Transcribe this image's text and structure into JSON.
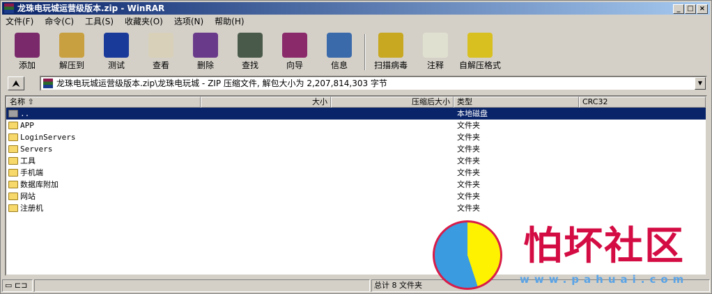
{
  "window": {
    "title": "龙珠电玩城运营级版本.zip - WinRAR",
    "min": "_",
    "max": "□",
    "close": "×"
  },
  "menu": [
    "文件(F)",
    "命令(C)",
    "工具(S)",
    "收藏夹(O)",
    "选项(N)",
    "帮助(H)"
  ],
  "toolbar": [
    {
      "label": "添加",
      "color": "#7a2a6a"
    },
    {
      "label": "解压到",
      "color": "#c8a040"
    },
    {
      "label": "测试",
      "color": "#1a3a9a"
    },
    {
      "label": "查看",
      "color": "#d8d0b8"
    },
    {
      "label": "删除",
      "color": "#6a3a8a"
    },
    {
      "label": "查找",
      "color": "#4a5a4a"
    },
    {
      "label": "向导",
      "color": "#8a2a6a"
    },
    {
      "label": "信息",
      "color": "#3a6aaa"
    }
  ],
  "toolbar2": [
    {
      "label": "扫描病毒",
      "color": "#c8a820"
    },
    {
      "label": "注释",
      "color": "#e0e0d0"
    },
    {
      "label": "自解压格式",
      "color": "#d8c020"
    }
  ],
  "address": {
    "up": "⮝",
    "path": "龙珠电玩城运营级版本.zip\\龙珠电玩城 - ZIP 压缩文件, 解包大小为 2,207,814,303 字节",
    "dropdown": "▼"
  },
  "columns": {
    "name": "名称 ⇧",
    "size": "大小",
    "packed": "压缩后大小",
    "type": "类型",
    "crc": "CRC32"
  },
  "rows": [
    {
      "name": "..",
      "type": "本地磁盘",
      "selected": true
    },
    {
      "name": "APP",
      "type": "文件夹"
    },
    {
      "name": "LoginServers",
      "type": "文件夹"
    },
    {
      "name": "Servers",
      "type": "文件夹"
    },
    {
      "name": "工具",
      "type": "文件夹"
    },
    {
      "name": "手机端",
      "type": "文件夹"
    },
    {
      "name": "数据库附加",
      "type": "文件夹"
    },
    {
      "name": "网站",
      "type": "文件夹"
    },
    {
      "name": "注册机",
      "type": "文件夹"
    }
  ],
  "status": {
    "left": "▭ ⊏⊐",
    "total": "总计 8 文件夹"
  },
  "watermark": {
    "name": "怕坏社区",
    "url": "www.pahuai.com"
  }
}
